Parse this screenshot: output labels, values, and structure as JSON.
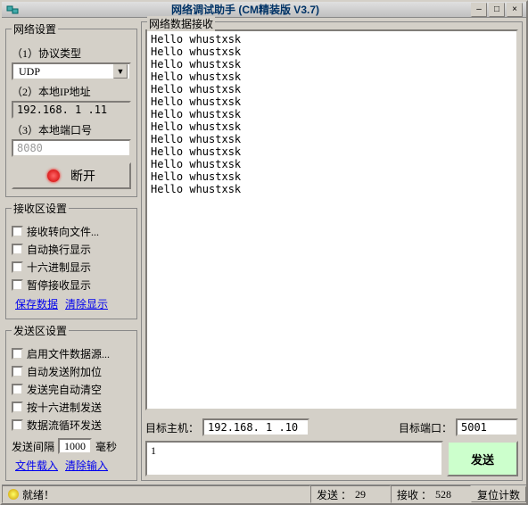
{
  "title": "网络调试助手 (CM精装版 V3.7)",
  "net": {
    "legend": "网络设置",
    "proto_label": "（1）协议类型",
    "proto_value": "UDP",
    "ip_label": "（2）本地IP地址",
    "ip_value": "192.168. 1 .11",
    "port_label": "（3）本地端口号",
    "port_value": "8080",
    "disconnect": "断开"
  },
  "recv_opts": {
    "legend": "接收区设置",
    "items": [
      "接收转向文件...",
      "自动换行显示",
      "十六进制显示",
      "暂停接收显示"
    ],
    "links": {
      "save": "保存数据",
      "clear": "清除显示"
    }
  },
  "send_opts": {
    "legend": "发送区设置",
    "items": [
      "启用文件数据源...",
      "自动发送附加位",
      "发送完自动清空",
      "按十六进制发送",
      "数据流循环发送"
    ],
    "interval": {
      "label": "发送间隔",
      "value": "1000",
      "unit": "毫秒"
    },
    "links": {
      "load": "文件载入",
      "clear": "清除输入"
    }
  },
  "recv_area": {
    "legend": "网络数据接收",
    "lines": [
      "Hello whustxsk",
      "Hello whustxsk",
      "Hello whustxsk",
      "Hello whustxsk",
      "Hello whustxsk",
      "Hello whustxsk",
      "Hello whustxsk",
      "Hello whustxsk",
      "Hello whustxsk",
      "Hello whustxsk",
      "Hello whustxsk",
      "Hello whustxsk",
      "Hello whustxsk"
    ]
  },
  "target": {
    "host_label": "目标主机：",
    "host_value": "192.168. 1 .10",
    "port_label": "目标端口：",
    "port_value": "5001"
  },
  "send": {
    "text": "1",
    "button": "发送"
  },
  "status": {
    "ready": "就绪！",
    "send_label": "发送 ：",
    "send_count": "29",
    "recv_label": "接收 ：",
    "recv_count": "528",
    "reset": "复位计数"
  }
}
